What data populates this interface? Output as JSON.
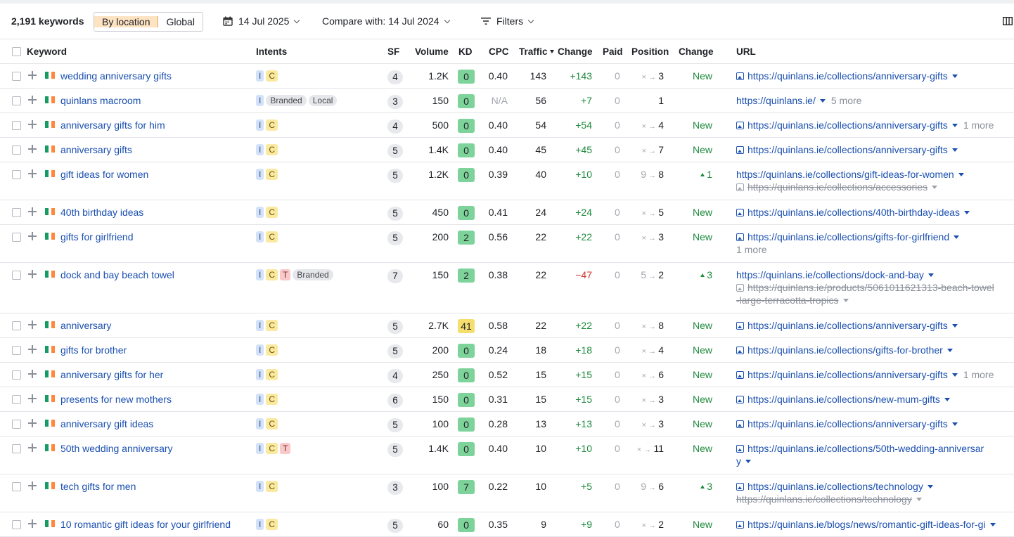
{
  "toolbar": {
    "keyword_count": "2,191 keywords",
    "seg_location": "By location",
    "seg_global": "Global",
    "date": "14 Jul 2025",
    "compare": "Compare with: 14 Jul 2024",
    "filters": "Filters",
    "accent_color": "#fde3c2"
  },
  "columns": {
    "keyword": "Keyword",
    "intents": "Intents",
    "sf": "SF",
    "volume": "Volume",
    "kd": "KD",
    "cpc": "CPC",
    "traffic": "Traffic",
    "traffic_change": "Change",
    "paid": "Paid",
    "position": "Position",
    "position_change": "Change",
    "url": "URL"
  },
  "rows": [
    {
      "kw": "wedding anniversary gifts",
      "tags": [
        "I",
        "C"
      ],
      "sf": "4",
      "vol": "1.2K",
      "kd": "0",
      "cpc": "0.40",
      "traffic": "143",
      "tchange": "+143",
      "paid": "0",
      "prev": "×",
      "pos": "3",
      "pchange": "New",
      "url": "https://quinlans.ie/collections/anniversary-gifts"
    },
    {
      "kw": "quinlans macroom",
      "tags": [
        "I"
      ],
      "tags2": [
        "Branded",
        "Local"
      ],
      "sf": "3",
      "vol": "150",
      "kd": "0",
      "cpc": "N/A",
      "traffic": "56",
      "tchange": "+7",
      "paid": "0",
      "pos": "1",
      "pchange": "",
      "url": "https://quinlans.ie/",
      "more": "5 more"
    },
    {
      "kw": "anniversary gifts for him",
      "tags": [
        "I",
        "C"
      ],
      "sf": "4",
      "vol": "500",
      "kd": "0",
      "cpc": "0.40",
      "traffic": "54",
      "tchange": "+54",
      "paid": "0",
      "prev": "×",
      "pos": "4",
      "pchange": "New",
      "url": "https://quinlans.ie/collections/anniversary-gifts",
      "more": "1 more"
    },
    {
      "kw": "anniversary gifts",
      "tags": [
        "I",
        "C"
      ],
      "sf": "5",
      "vol": "1.4K",
      "kd": "0",
      "cpc": "0.40",
      "traffic": "45",
      "tchange": "+45",
      "paid": "0",
      "prev": "×",
      "pos": "7",
      "pchange": "New",
      "url": "https://quinlans.ie/collections/anniversary-gifts"
    },
    {
      "kw": "gift ideas for women",
      "tags": [
        "I",
        "C"
      ],
      "sf": "5",
      "vol": "1.2K",
      "kd": "0",
      "cpc": "0.39",
      "traffic": "40",
      "tchange": "+10",
      "paid": "0",
      "prev": "9",
      "pos": "8",
      "pchange": "1",
      "url": "https://quinlans.ie/collections/gift-ideas-for-women",
      "url_old": "https://quinlans.ie/collections/accessories"
    },
    {
      "kw": "40th birthday ideas",
      "tags": [
        "I",
        "C"
      ],
      "sf": "5",
      "vol": "450",
      "kd": "0",
      "cpc": "0.41",
      "traffic": "24",
      "tchange": "+24",
      "paid": "0",
      "prev": "×",
      "pos": "5",
      "pchange": "New",
      "url": "https://quinlans.ie/collections/40th-birthday-ideas"
    },
    {
      "kw": "gifts for girlfriend",
      "tags": [
        "I",
        "C"
      ],
      "sf": "5",
      "vol": "200",
      "kd": "2",
      "cpc": "0.56",
      "traffic": "22",
      "tchange": "+22",
      "paid": "0",
      "prev": "×",
      "pos": "3",
      "pchange": "New",
      "url": "https://quinlans.ie/collections/gifts-for-girlfriend",
      "more2": "1 more"
    },
    {
      "kw": "dock and bay beach towel",
      "tags": [
        "I",
        "C",
        "T"
      ],
      "tags2": [
        "Branded"
      ],
      "sf": "7",
      "vol": "150",
      "kd": "2",
      "cpc": "0.38",
      "traffic": "22",
      "tchange": "−47",
      "paid": "0",
      "prev": "5",
      "pos": "2",
      "pchange": "3",
      "url": "https://quinlans.ie/collections/dock-and-bay",
      "url_old": "https://quinlans.ie/products/5061011621313-beach-towel",
      "url_old_cont": "-large-terracotta-tropics"
    },
    {
      "kw": "anniversary",
      "tags": [
        "I",
        "C"
      ],
      "sf": "5",
      "vol": "2.7K",
      "kd": "41",
      "cpc": "0.58",
      "traffic": "22",
      "tchange": "+22",
      "paid": "0",
      "prev": "×",
      "pos": "8",
      "pchange": "New",
      "url": "https://quinlans.ie/collections/anniversary-gifts"
    },
    {
      "kw": "gifts for brother",
      "tags": [
        "I",
        "C"
      ],
      "sf": "5",
      "vol": "200",
      "kd": "0",
      "cpc": "0.24",
      "traffic": "18",
      "tchange": "+18",
      "paid": "0",
      "prev": "×",
      "pos": "4",
      "pchange": "New",
      "url": "https://quinlans.ie/collections/gifts-for-brother"
    },
    {
      "kw": "anniversary gifts for her",
      "tags": [
        "I",
        "C"
      ],
      "sf": "4",
      "vol": "250",
      "kd": "0",
      "cpc": "0.52",
      "traffic": "15",
      "tchange": "+15",
      "paid": "0",
      "prev": "×",
      "pos": "6",
      "pchange": "New",
      "url": "https://quinlans.ie/collections/anniversary-gifts",
      "more": "1 more"
    },
    {
      "kw": "presents for new mothers",
      "tags": [
        "I",
        "C"
      ],
      "sf": "6",
      "vol": "150",
      "kd": "0",
      "cpc": "0.31",
      "traffic": "15",
      "tchange": "+15",
      "paid": "0",
      "prev": "×",
      "pos": "3",
      "pchange": "New",
      "url": "https://quinlans.ie/collections/new-mum-gifts"
    },
    {
      "kw": "anniversary gift ideas",
      "tags": [
        "I",
        "C"
      ],
      "sf": "5",
      "vol": "100",
      "kd": "0",
      "cpc": "0.28",
      "traffic": "13",
      "tchange": "+13",
      "paid": "0",
      "prev": "×",
      "pos": "3",
      "pchange": "New",
      "url": "https://quinlans.ie/collections/anniversary-gifts"
    },
    {
      "kw": "50th wedding anniversary",
      "tags": [
        "I",
        "C",
        "T"
      ],
      "sf": "5",
      "vol": "1.4K",
      "kd": "0",
      "cpc": "0.40",
      "traffic": "10",
      "tchange": "+10",
      "paid": "0",
      "prev": "×",
      "pos": "11",
      "pchange": "New",
      "url": "https://quinlans.ie/collections/50th-wedding-anniversar",
      "url_cont": "y"
    },
    {
      "kw": "tech gifts for men",
      "tags": [
        "I",
        "C"
      ],
      "sf": "3",
      "vol": "100",
      "kd": "7",
      "cpc": "0.22",
      "traffic": "10",
      "tchange": "+5",
      "paid": "0",
      "prev": "9",
      "pos": "6",
      "pchange": "3",
      "url": "https://quinlans.ie/collections/technology",
      "url_old": "https://quinlans.ie/collections/technology"
    },
    {
      "kw": "10 romantic gift ideas for your girlfriend",
      "tags": [
        "I",
        "C"
      ],
      "sf": "5",
      "vol": "60",
      "kd": "0",
      "cpc": "0.35",
      "traffic": "9",
      "tchange": "+9",
      "paid": "0",
      "prev": "×",
      "pos": "2",
      "pchange": "New",
      "url": "https://quinlans.ie/blogs/news/romantic-gift-ideas-for-gi"
    }
  ]
}
